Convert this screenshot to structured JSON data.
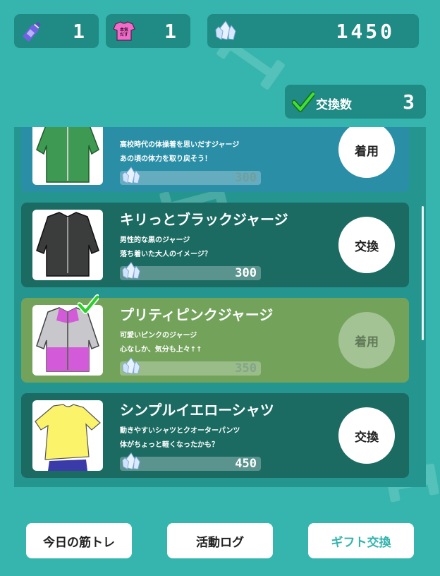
{
  "counters": {
    "bottle": {
      "icon": "water-bottle-icon",
      "value": "1"
    },
    "shirt": {
      "icon": "pink-shirt-icon",
      "icon_text": "本気だす",
      "value": "1"
    },
    "gems": {
      "icon": "crystal-icon",
      "value": "1450"
    }
  },
  "exchange_count": {
    "label": "交換数",
    "value": "3"
  },
  "items": [
    {
      "name": "",
      "desc1": "高校時代の体操着を思いだすジャージ",
      "desc2": "あの頃の体力を取り戻そう！",
      "price": "300",
      "action": "着用",
      "state": "equipped",
      "checked": true,
      "image": "green-jersey"
    },
    {
      "name": "キリっとブラックジャージ",
      "desc1": "男性的な黒のジャージ",
      "desc2": "落ち着いた大人のイメージ？",
      "price": "300",
      "action": "交換",
      "state": "normal",
      "checked": false,
      "image": "black-jersey"
    },
    {
      "name": "プリティピンクジャージ",
      "desc1": "可愛いピンクのジャージ",
      "desc2": "心なしか、気分も上々↑↑",
      "price": "350",
      "action": "着用",
      "state": "owned",
      "checked": true,
      "image": "pink-jersey"
    },
    {
      "name": "シンプルイエローシャツ",
      "desc1": "動きやすいシャツとクオーターパンツ",
      "desc2": "体がちょっと軽くなったかも？",
      "price": "450",
      "action": "交換",
      "state": "normal",
      "checked": false,
      "image": "yellow-shirt"
    }
  ],
  "nav": {
    "training": "今日の筋トレ",
    "log": "活動ログ",
    "gift": "ギフト交換"
  },
  "colors": {
    "background": "#35b5ad",
    "card_normal": "#1c6b63",
    "card_equipped": "#2a8ea6",
    "card_owned": "#73a35b",
    "accent": "#34b3ad"
  }
}
